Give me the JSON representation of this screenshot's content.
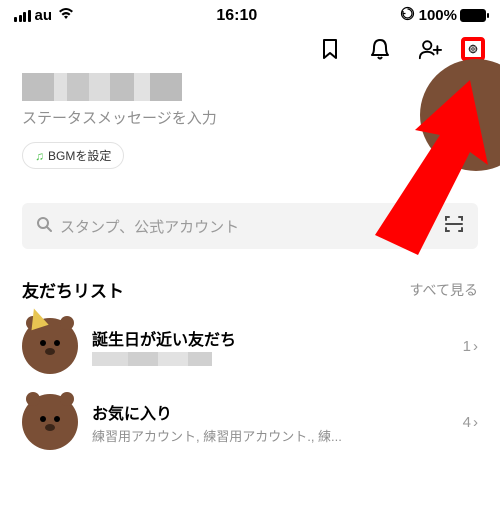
{
  "status_bar": {
    "carrier": "au",
    "time": "16:10",
    "battery_pct": "100%"
  },
  "profile": {
    "status_placeholder": "ステータスメッセージを入力",
    "bgm_label": "BGMを設定"
  },
  "search": {
    "placeholder": "スタンプ、公式アカウント"
  },
  "friend_list": {
    "title": "友だちリスト",
    "see_all": "すべて見る",
    "items": [
      {
        "title": "誕生日が近い友だち",
        "subtitle": "",
        "count": "1"
      },
      {
        "title": "お気に入り",
        "subtitle": "練習用アカウント, 練習用アカウント., 練...",
        "count": "4"
      }
    ]
  }
}
